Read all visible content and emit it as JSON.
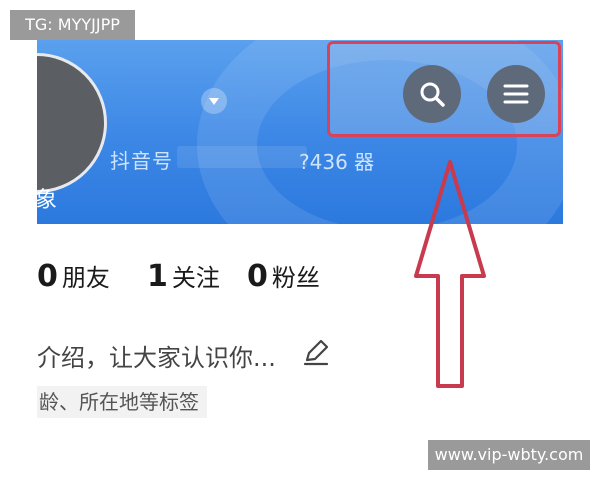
{
  "watermark": {
    "top_left": "TG: MYYJJPP",
    "bottom_right": "www.vip-wbty.com"
  },
  "header": {
    "avatar_text": "象",
    "id_label": "抖音号",
    "id_suffix": "?436 器",
    "gradient_colors": [
      "#5aa0ee",
      "#2c79de"
    ]
  },
  "top_actions": {
    "search_icon": "search-icon",
    "menu_icon": "hamburger-menu-icon",
    "highlight_color": "#d8435a"
  },
  "stats": [
    {
      "value": "0",
      "label": "朋友"
    },
    {
      "value": "1",
      "label": "关注"
    },
    {
      "value": "0",
      "label": "粉丝"
    }
  ],
  "profile": {
    "bio_placeholder": "介绍，让大家认识你...",
    "tags_placeholder": "龄、所在地等标签"
  },
  "annotation": {
    "arrow_color": "#c83a4e"
  }
}
